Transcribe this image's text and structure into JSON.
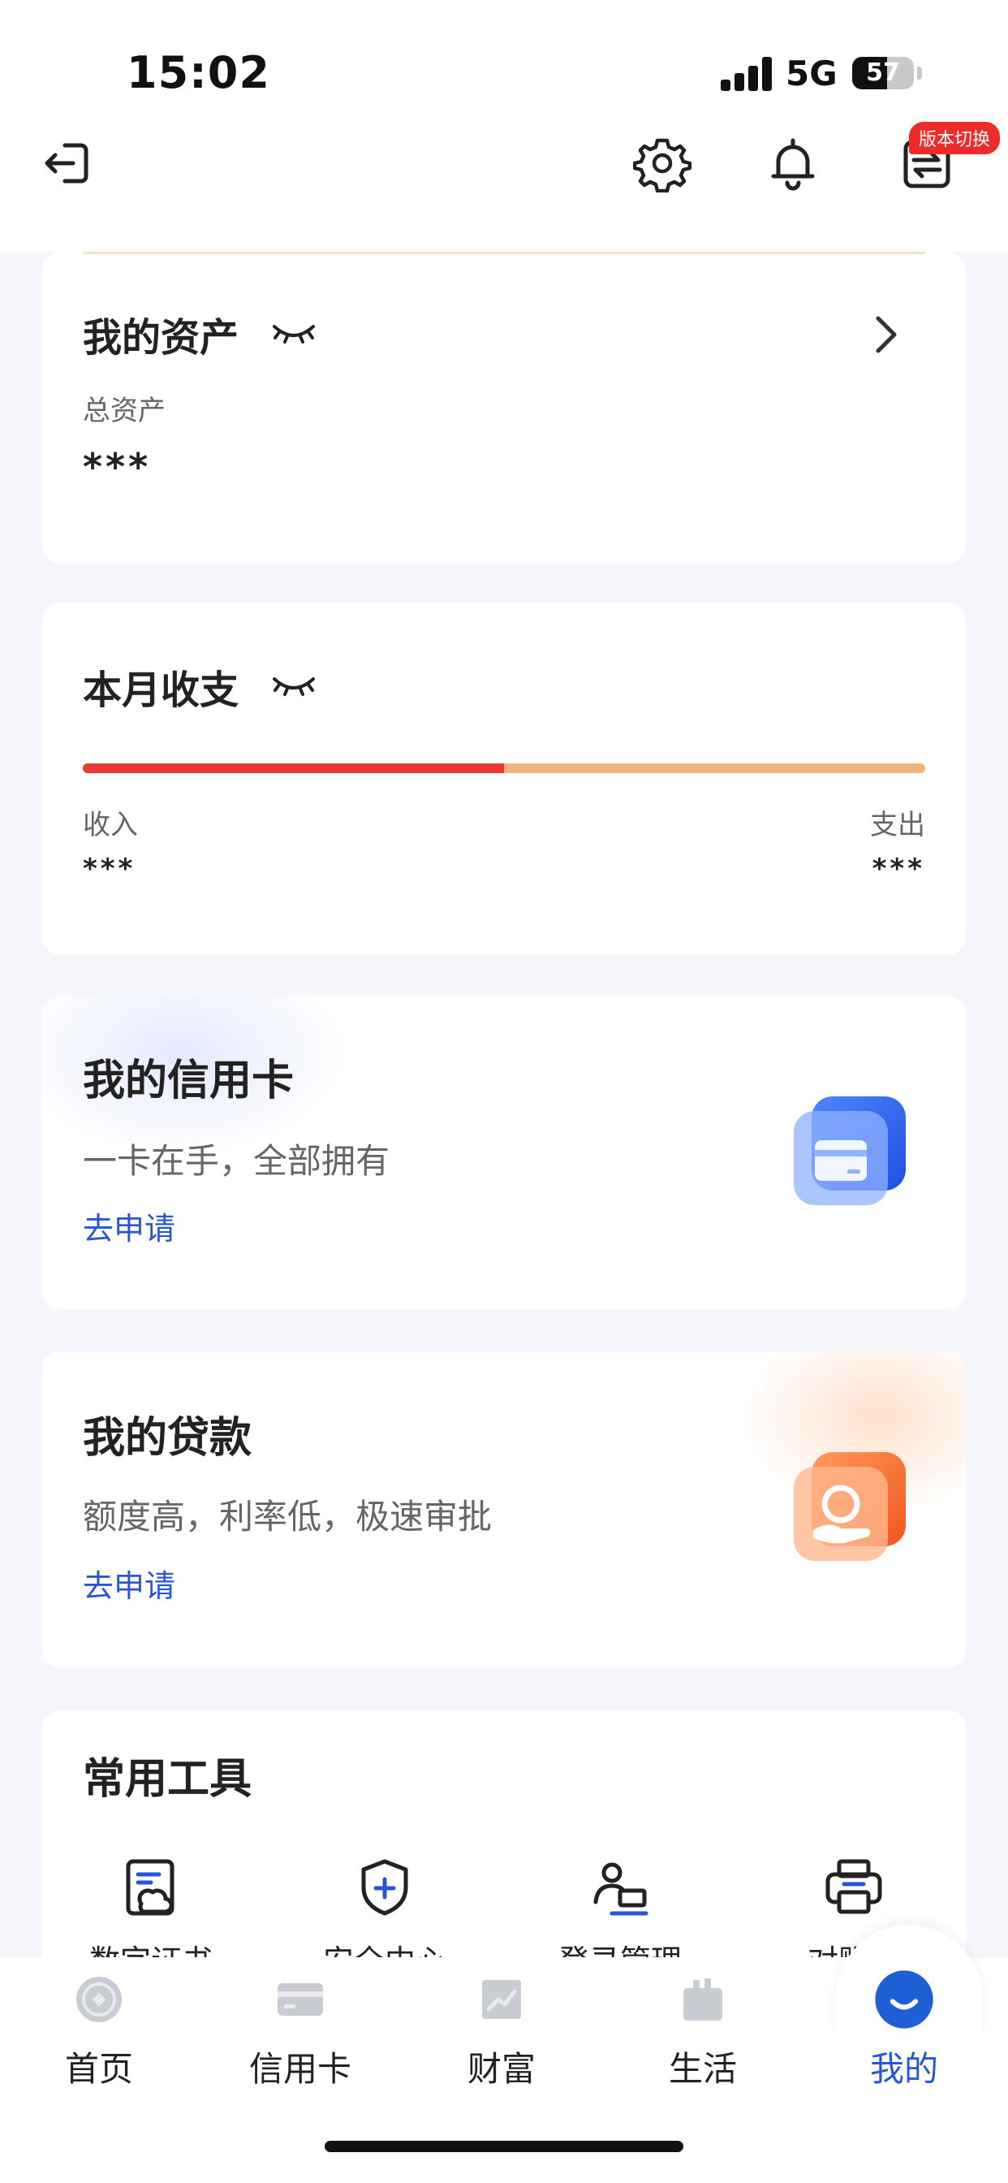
{
  "status_bar": {
    "time": "15:02",
    "network": "5G",
    "battery": "57",
    "battery_level": 0.57
  },
  "header": {
    "icons": [
      "exit-icon",
      "gear-icon",
      "bell-icon",
      "switch-version-icon"
    ],
    "version_badge": "版本切换"
  },
  "assets_card": {
    "title": "我的资产",
    "total_label": "总资产",
    "total_value": "***"
  },
  "monthly_card": {
    "title": "本月收支",
    "income_label": "收入",
    "income_value": "***",
    "expense_label": "支出",
    "expense_value": "***",
    "income_ratio": 0.5
  },
  "credit_card_promo": {
    "title": "我的信用卡",
    "description": "一卡在手，全部拥有",
    "action": "去申请"
  },
  "loan_promo": {
    "title": "我的贷款",
    "description": "额度高，利率低，极速审批",
    "action": "去申请"
  },
  "tools": {
    "title": "常用工具",
    "items": [
      {
        "label": "数字证书",
        "icon": "certificate-icon"
      },
      {
        "label": "安全中心",
        "icon": "shield-icon"
      },
      {
        "label": "登录管理",
        "icon": "login-manage-icon"
      },
      {
        "label": "对账单",
        "icon": "printer-icon"
      }
    ]
  },
  "tabbar": {
    "tabs": [
      {
        "label": "首页",
        "icon": "home-coin-icon"
      },
      {
        "label": "信用卡",
        "icon": "credit-card-icon"
      },
      {
        "label": "财富",
        "icon": "wealth-chart-icon"
      },
      {
        "label": "生活",
        "icon": "life-bag-icon"
      },
      {
        "label": "我的",
        "icon": "mine-smile-icon"
      }
    ],
    "active": "我的"
  },
  "colors": {
    "accent": "#2757d8",
    "expense_bar": "#f3b37d",
    "income_bar": "#e93a31",
    "badge": "#ee2a2a"
  }
}
